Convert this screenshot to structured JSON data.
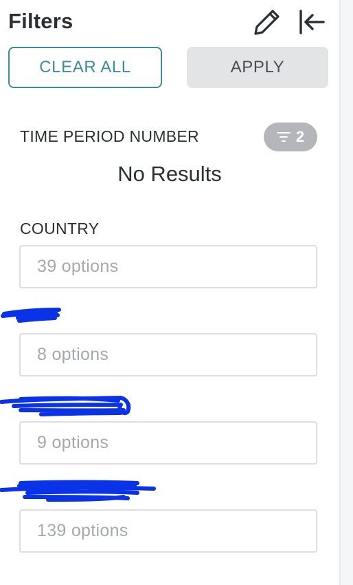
{
  "header": {
    "title": "Filters",
    "edit_icon": "pencil-icon",
    "collapse_icon": "collapse-left-icon"
  },
  "actions": {
    "clear_label": "CLEAR ALL",
    "apply_label": "APPLY"
  },
  "time_period": {
    "label": "TIME PERIOD NUMBER",
    "badge_icon": "filter-icon",
    "badge_count": "2",
    "empty_message": "No Results"
  },
  "filters": [
    {
      "label": "COUNTRY",
      "placeholder": "39 options"
    },
    {
      "label": "",
      "placeholder": "8 options"
    },
    {
      "label": "",
      "placeholder": "9 options"
    },
    {
      "label": "",
      "placeholder": "139 options"
    }
  ],
  "colors": {
    "accent": "#3e8c98",
    "redaction": "#0a32e6",
    "badge_bg": "#b4b6b9",
    "apply_bg": "#e3e4e6"
  }
}
